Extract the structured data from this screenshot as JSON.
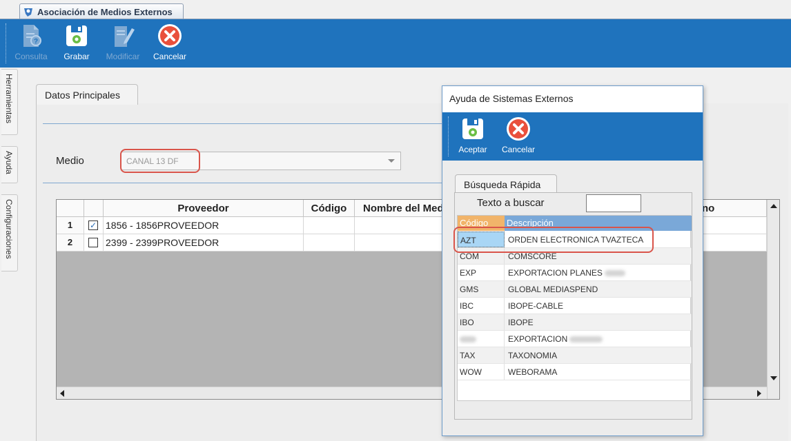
{
  "window": {
    "title": "Asociación de Medios Externos"
  },
  "toolbar": {
    "consulta": "Consulta",
    "grabar": "Grabar",
    "modificar": "Modificar",
    "cancelar": "Cancelar"
  },
  "sidebar": {
    "tabs": [
      {
        "label": "Herramientas"
      },
      {
        "label": "Ayuda"
      },
      {
        "label": "Configuraciones"
      }
    ]
  },
  "main": {
    "tab_label": "Datos Principales",
    "medio_label": "Medio",
    "medio_value": "CANAL 13 DF"
  },
  "grid": {
    "columns": [
      "Proveedor",
      "Código",
      "Nombre del Med",
      "no"
    ],
    "rows": [
      {
        "num": "1",
        "checked": true,
        "proveedor": "1856 - 1856PROVEEDOR"
      },
      {
        "num": "2",
        "checked": false,
        "proveedor": "2399 - 2399PROVEEDOR"
      }
    ]
  },
  "dialog": {
    "title": "Ayuda de Sistemas Externos",
    "aceptar": "Aceptar",
    "cancelar": "Cancelar",
    "tab_label": "Búsqueda Rápida",
    "search_label": "Texto a buscar",
    "search_value": "",
    "list_headers": [
      "Código",
      "Descripción"
    ],
    "rows": [
      {
        "code": "AZT",
        "desc": "ORDEN ELECTRONICA TVAZTECA",
        "selected": true
      },
      {
        "code": "COM",
        "desc": "COMSCORE"
      },
      {
        "code": "EXP",
        "desc": "EXPORTACION PLANES"
      },
      {
        "code": "GMS",
        "desc": "GLOBAL MEDIASPEND"
      },
      {
        "code": "IBC",
        "desc": "IBOPE-CABLE"
      },
      {
        "code": "IBO",
        "desc": "IBOPE"
      },
      {
        "code": "",
        "desc": "EXPORTACION"
      },
      {
        "code": "TAX",
        "desc": "TAXONOMIA"
      },
      {
        "code": "WOW",
        "desc": "WEBORAMA"
      }
    ]
  },
  "colors": {
    "toolbar_blue": "#1f73bd",
    "highlight_red": "#d9544a",
    "list_header_orange": "#f1b46a",
    "list_header_blue": "#7aa8d8",
    "selected_cell": "#a9d6f5"
  }
}
